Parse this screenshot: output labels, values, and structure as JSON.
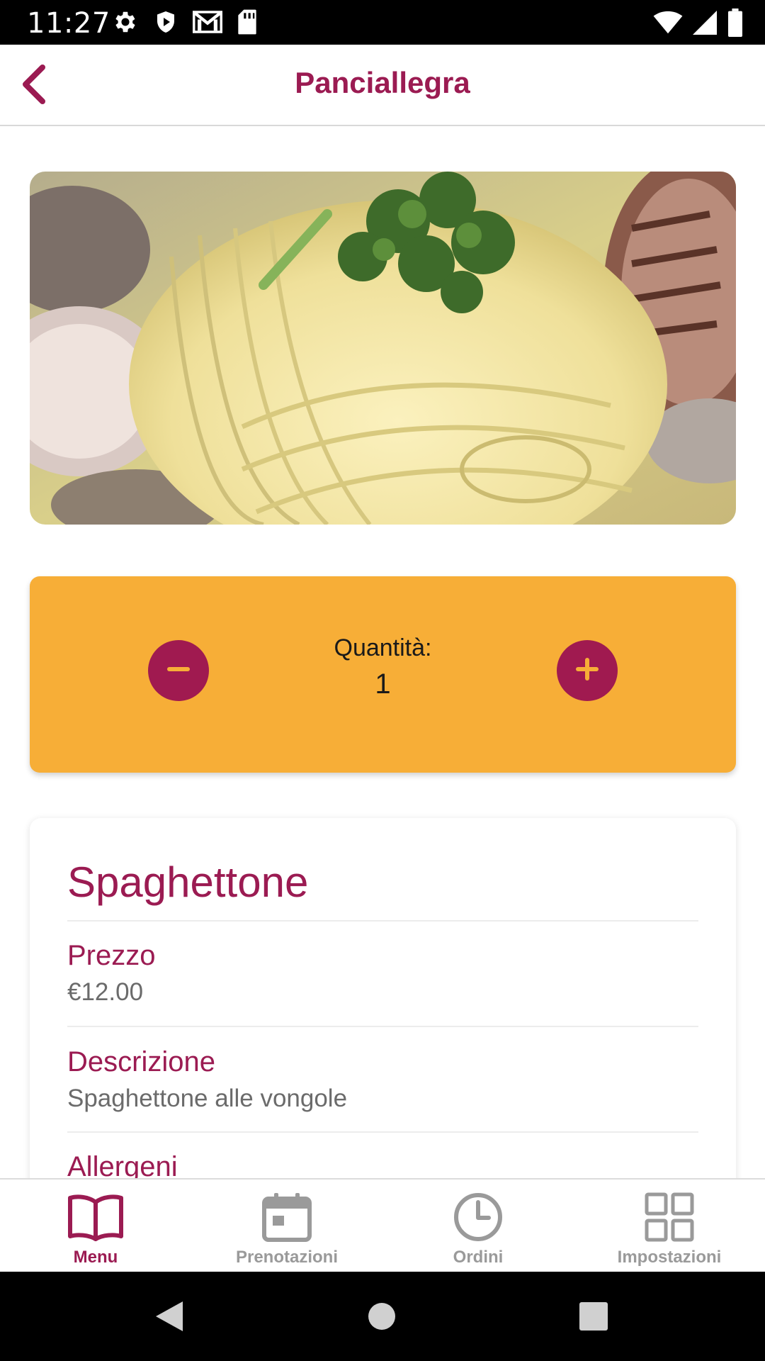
{
  "status_bar": {
    "time": "11:27",
    "left_icons": [
      "gear-icon",
      "shield-icon",
      "gmail-icon",
      "sd-card-icon"
    ],
    "right_icons": [
      "wifi-icon",
      "signal-icon",
      "battery-icon"
    ]
  },
  "app_bar": {
    "title": "Panciallegra",
    "back_icon": "chevron-left-icon"
  },
  "colors": {
    "primary": "#9b1b52",
    "accent_card": "#f7ae37",
    "muted_text": "#6b6b6b",
    "inactive_nav": "#9a9a9a"
  },
  "dish_image": {
    "icon": "food-photo"
  },
  "quantity": {
    "label": "Quantità:",
    "value": "1",
    "minus_icon": "minus-circle-icon",
    "plus_icon": "plus-circle-icon"
  },
  "dish": {
    "name": "Spaghettone",
    "fields": [
      {
        "label": "Prezzo",
        "value": "€12.00"
      },
      {
        "label": "Descrizione",
        "value": "Spaghettone alle vongole"
      },
      {
        "label": "Allergeni",
        "value": ""
      }
    ]
  },
  "bottom_nav": {
    "items": [
      {
        "label": "Menu",
        "icon": "book-icon",
        "active": true
      },
      {
        "label": "Prenotazioni",
        "icon": "calendar-icon",
        "active": false
      },
      {
        "label": "Ordini",
        "icon": "clock-icon",
        "active": false
      },
      {
        "label": "Impostazioni",
        "icon": "grid-icon",
        "active": false
      }
    ]
  },
  "system_nav": {
    "icons": [
      "back-triangle-icon",
      "home-circle-icon",
      "recents-square-icon"
    ]
  }
}
